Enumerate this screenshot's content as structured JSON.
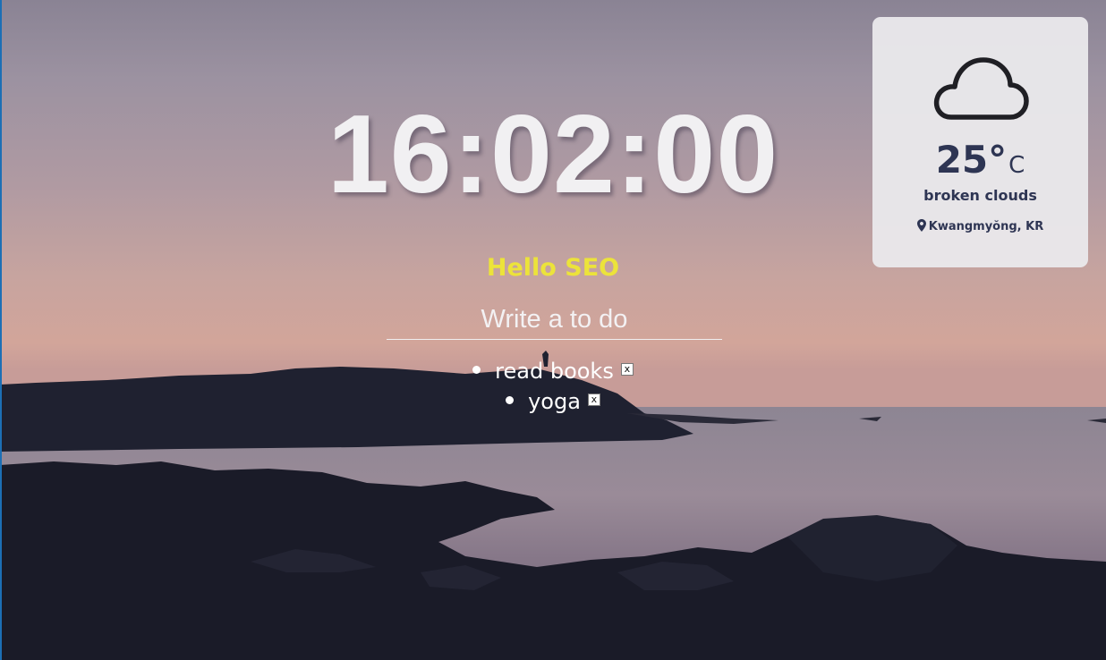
{
  "clock": {
    "time": "16:02:00"
  },
  "greeting": {
    "text": "Hello SEO",
    "color": "#ece33a"
  },
  "todo": {
    "placeholder": "Write a to do",
    "items": [
      {
        "text": "read books",
        "delete_label": "x"
      },
      {
        "text": "yoga",
        "delete_label": "x"
      }
    ]
  },
  "weather": {
    "icon": "cloud-icon",
    "temperature": "25°",
    "unit": "C",
    "description": "broken clouds",
    "location_icon": "map-pin-icon",
    "location": "Kwangmyŏng, KR"
  },
  "colors": {
    "accent_text": "#2e3553",
    "greeting": "#ece33a",
    "clock": "#f1f0f2"
  }
}
